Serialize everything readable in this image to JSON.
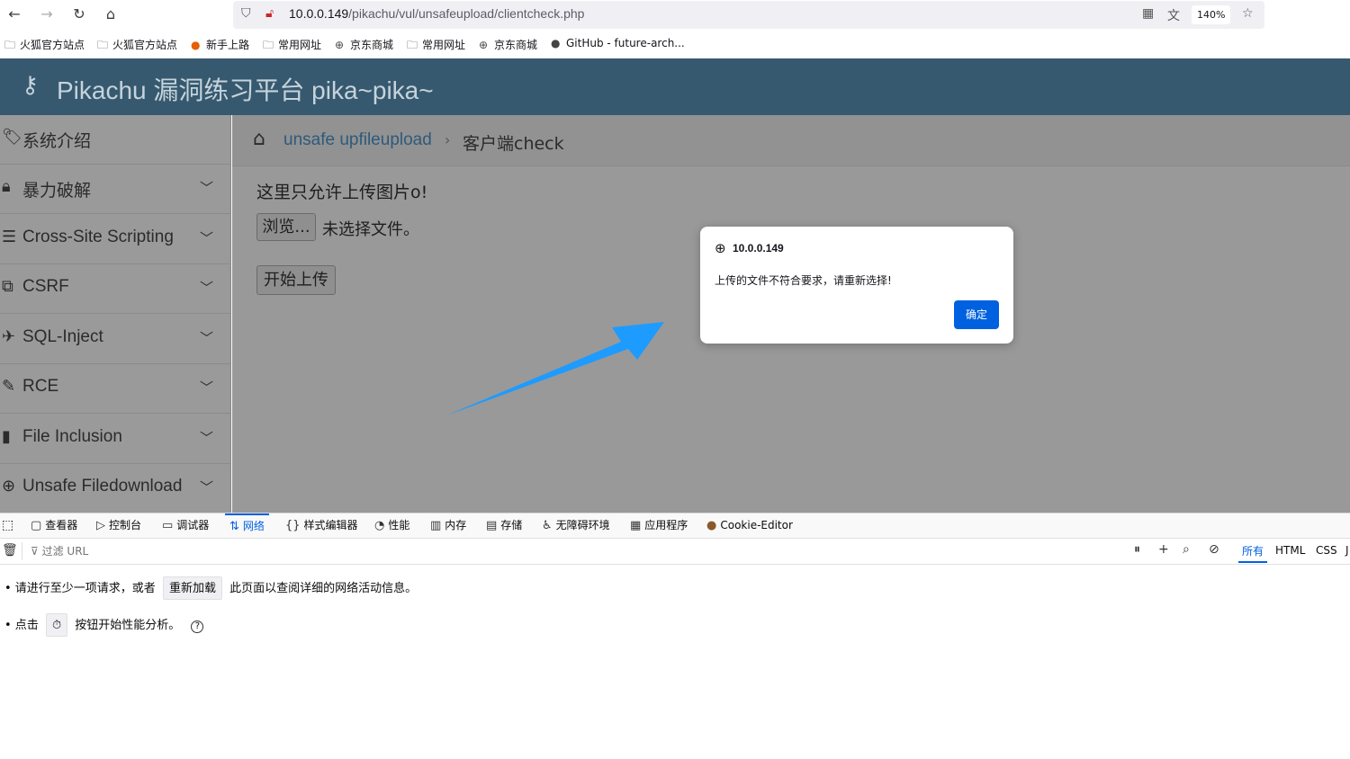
{
  "browser": {
    "url_host": "10.0.0.149",
    "url_path": "/pikachu/vul/unsafeupload/clientcheck.php",
    "zoom": "140%",
    "bookmarks": [
      {
        "icon": "folder-icon",
        "label": "火狐官方站点"
      },
      {
        "icon": "folder-icon",
        "label": "火狐官方站点"
      },
      {
        "icon": "firefox-icon",
        "label": "新手上路"
      },
      {
        "icon": "folder-icon",
        "label": "常用网址"
      },
      {
        "icon": "globe-icon",
        "label": "京东商城"
      },
      {
        "icon": "folder-icon",
        "label": "常用网址"
      },
      {
        "icon": "globe-icon",
        "label": "京东商城"
      },
      {
        "icon": "github-icon",
        "label": "GitHub - future-arch..."
      }
    ]
  },
  "site": {
    "title": "Pikachu 漏洞练习平台 pika~pika~"
  },
  "sidebar": {
    "items": [
      {
        "icon": "tags-icon",
        "label": "系统介绍"
      },
      {
        "icon": "lock-icon",
        "label": "暴力破解"
      },
      {
        "icon": "list-icon",
        "label": "Cross-Site Scripting"
      },
      {
        "icon": "external-icon",
        "label": "CSRF"
      },
      {
        "icon": "plane-icon",
        "label": "SQL-Inject"
      },
      {
        "icon": "pencil-icon",
        "label": "RCE"
      },
      {
        "icon": "file-icon",
        "label": "File Inclusion"
      },
      {
        "icon": "download-icon",
        "label": "Unsafe Filedownload"
      }
    ]
  },
  "main": {
    "breadcrumb_link": "unsafe upfileupload",
    "breadcrumb_current": "客户端check",
    "hint": "这里只允许上传图片o!",
    "browse_label": "浏览...",
    "file_status": "未选择文件。",
    "upload_label": "开始上传"
  },
  "dialog": {
    "title": "10.0.0.149",
    "message": "上传的文件不符合要求，请重新选择!",
    "ok_label": "确定"
  },
  "devtools": {
    "tabs": [
      {
        "icon": "inspector-icon",
        "label": "查看器"
      },
      {
        "icon": "console-icon",
        "label": "控制台"
      },
      {
        "icon": "debugger-icon",
        "label": "调试器"
      },
      {
        "icon": "network-icon",
        "label": "网络"
      },
      {
        "icon": "style-editor-icon",
        "label": "样式编辑器"
      },
      {
        "icon": "performance-icon",
        "label": "性能"
      },
      {
        "icon": "memory-icon",
        "label": "内存"
      },
      {
        "icon": "storage-icon",
        "label": "存储"
      },
      {
        "icon": "accessibility-icon",
        "label": "无障碍环境"
      },
      {
        "icon": "application-icon",
        "label": "应用程序"
      },
      {
        "icon": "cookie-icon",
        "label": "Cookie-Editor"
      }
    ],
    "filter_placeholder": "过滤 URL",
    "type_filters": [
      "所有",
      "HTML",
      "CSS",
      "J"
    ],
    "line1_before": "• 请进行至少一项请求，或者",
    "reload_label": "重新加载",
    "line1_after": "此页面以查阅详细的网络活动信息。",
    "line2_before": "• 点击",
    "line2_after": "按钮开始性能分析。"
  },
  "colors": {
    "header_bg": "#36596f",
    "accent": "#0061e0",
    "arrow": "#1e9bff"
  }
}
